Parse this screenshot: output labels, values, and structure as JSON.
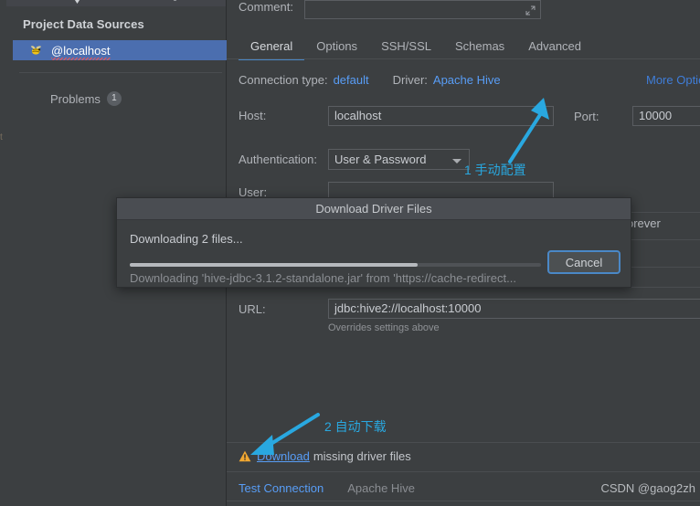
{
  "left_panel": {
    "title": "Project Data Sources",
    "data_source": {
      "label": "@localhost",
      "icon": "hive-bee-icon"
    },
    "problems": {
      "label": "Problems",
      "count": "1"
    }
  },
  "content": {
    "comment": {
      "label": "Comment:",
      "value": "",
      "expand_icon": "expand-icon"
    },
    "tabs": [
      {
        "label": "General",
        "active": true
      },
      {
        "label": "Options",
        "active": false
      },
      {
        "label": "SSH/SSL",
        "active": false
      },
      {
        "label": "Schemas",
        "active": false
      },
      {
        "label": "Advanced",
        "active": false
      }
    ],
    "connection_type": {
      "label": "Connection type:",
      "value": "default"
    },
    "driver": {
      "label": "Driver:",
      "value": "Apache Hive"
    },
    "more_options": "More Optio",
    "host": {
      "label": "Host:",
      "value": "localhost"
    },
    "port": {
      "label": "Port:",
      "value": "10000"
    },
    "authentication": {
      "label": "Authentication:",
      "value": "User & Password"
    },
    "user": {
      "label": "User:",
      "value": ""
    },
    "save_value": "orever",
    "url": {
      "label": "URL:",
      "value": "jdbc:hive2://localhost:10000",
      "hint": "Overrides settings above"
    },
    "download_notice": {
      "warning_icon": "warning-triangle-icon",
      "link": "Download",
      "rest": " missing driver files"
    },
    "status_bar": {
      "test_connection": "Test Connection",
      "driver_name": "Apache Hive",
      "watermark": "CSDN @gaog2zh"
    }
  },
  "dialog": {
    "title": "Download Driver Files",
    "status": "Downloading 2 files...",
    "detail": "Downloading 'hive-jdbc-3.1.2-standalone.jar' from 'https://cache-redirect...",
    "progress_percent": 70,
    "cancel_label": "Cancel"
  },
  "annotations": {
    "one": "1 手动配置",
    "two": "2 自动下载",
    "accent_color": "#29a8e0"
  },
  "colors": {
    "background": "#3c3f41",
    "selection": "#4b6eaf",
    "link": "#589df6",
    "tab_underline": "#4a88c7",
    "warning": "#f0a732"
  }
}
